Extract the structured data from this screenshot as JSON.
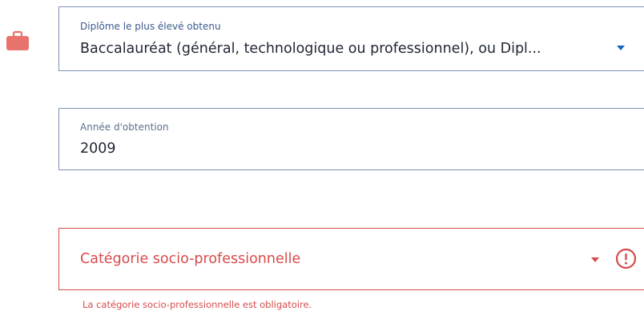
{
  "colors": {
    "accent": "#1565c8",
    "error": "#d94a4a",
    "border": "#7d92b4",
    "icon": "#e8736d"
  },
  "icons": {
    "briefcase": "briefcase-icon",
    "diploma_caret": "chevron-down-icon",
    "category_caret": "chevron-down-icon",
    "alert": "alert-circle-icon"
  },
  "diploma": {
    "label": "Diplôme le plus élevé obtenu",
    "value": "Baccalauréat (général, technologique ou professionnel), ou Dipl..."
  },
  "year": {
    "label": "Année d'obtention",
    "value": "2009"
  },
  "category": {
    "placeholder": "Catégorie socio-professionnelle",
    "error": "La catégorie socio-professionnelle est obligatoire."
  }
}
